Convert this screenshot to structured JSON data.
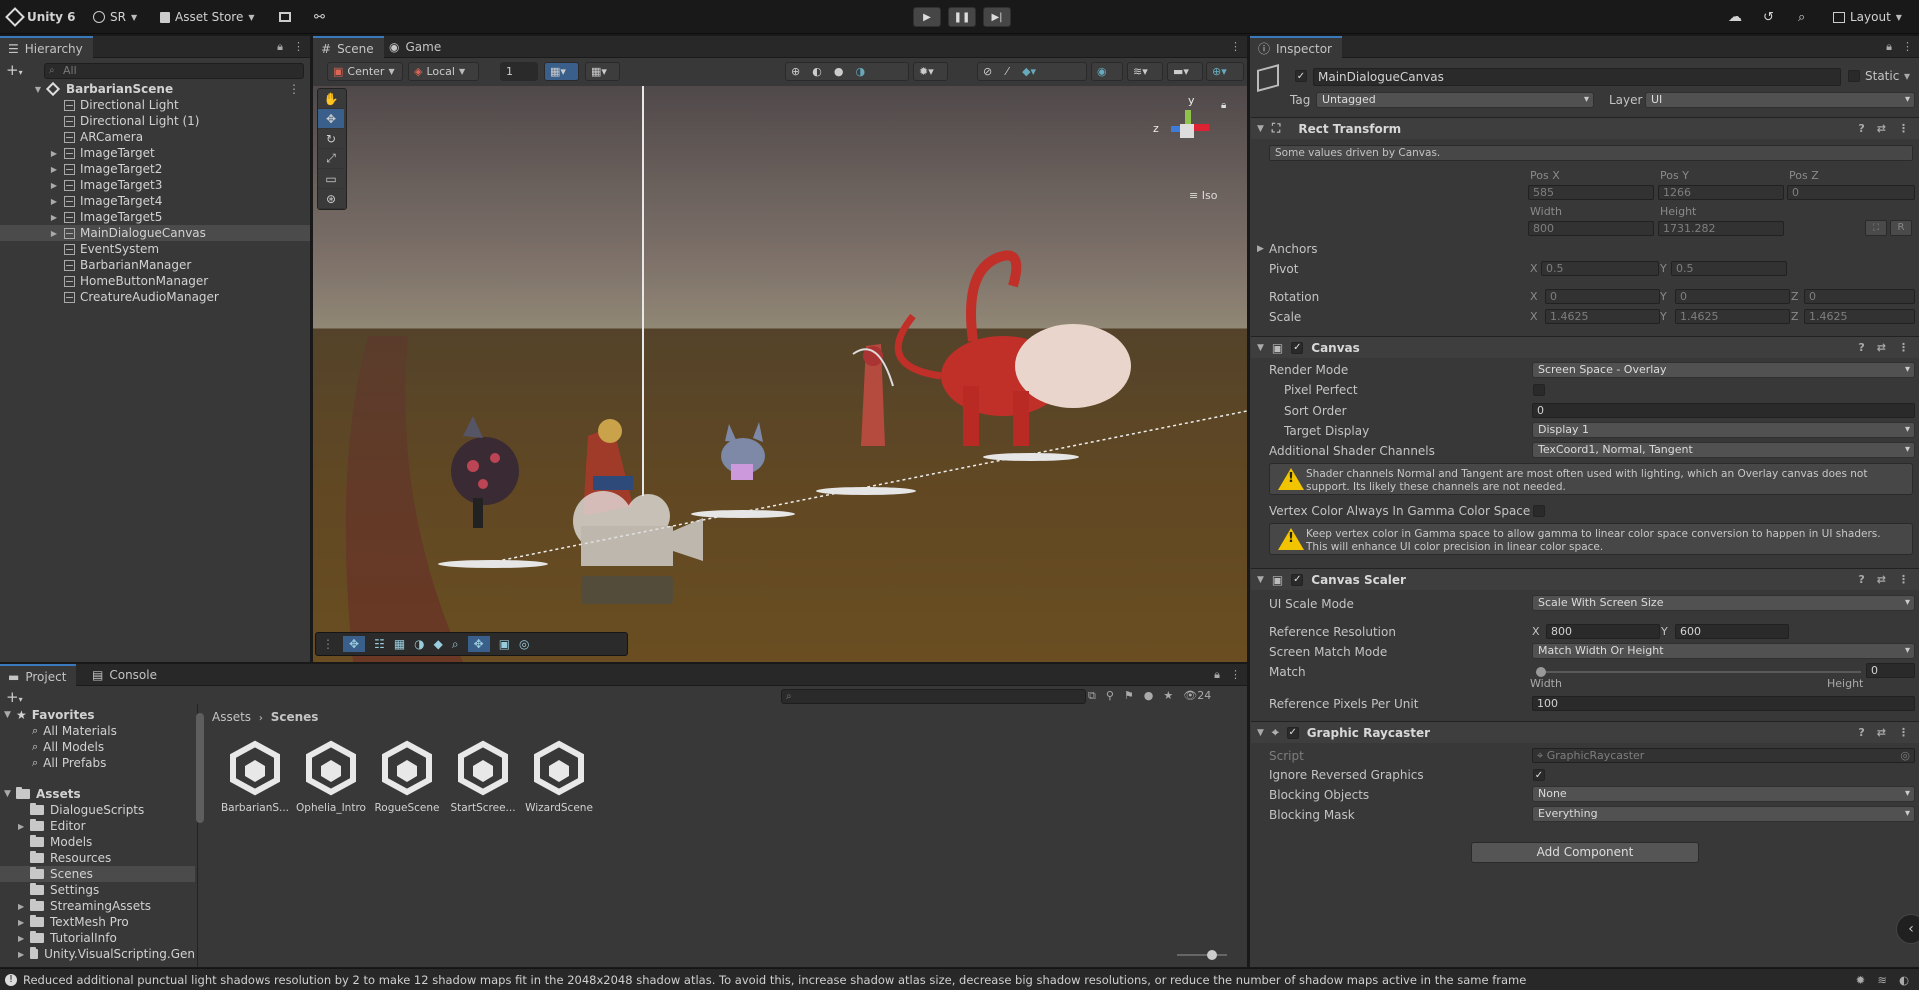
{
  "toolbar": {
    "app_title": "Unity 6",
    "account": "SR",
    "asset_store": "Asset Store",
    "layout": "Layout"
  },
  "hierarchy": {
    "tab": "Hierarchy",
    "search_placeholder": "All",
    "scene_name": "BarbarianScene",
    "items": [
      {
        "label": "Directional Light",
        "expandable": false
      },
      {
        "label": "Directional Light (1)",
        "expandable": false
      },
      {
        "label": "ARCamera",
        "expandable": false
      },
      {
        "label": "ImageTarget",
        "expandable": true
      },
      {
        "label": "ImageTarget2",
        "expandable": true
      },
      {
        "label": "ImageTarget3",
        "expandable": true
      },
      {
        "label": "ImageTarget4",
        "expandable": true
      },
      {
        "label": "ImageTarget5",
        "expandable": true
      },
      {
        "label": "MainDialogueCanvas",
        "expandable": true,
        "selected": true
      },
      {
        "label": "EventSystem",
        "expandable": false
      },
      {
        "label": "BarbarianManager",
        "expandable": false
      },
      {
        "label": "HomeButtonManager",
        "expandable": false
      },
      {
        "label": "CreatureAudioManager",
        "expandable": false
      }
    ]
  },
  "scene": {
    "tabs": [
      "Scene",
      "Game"
    ],
    "pivot": "Center",
    "space": "Local",
    "grid_value": "1",
    "gizmo_y": "y",
    "gizmo_z": "z",
    "projection": "Iso"
  },
  "inspector": {
    "tab": "Inspector",
    "object_name": "MainDialogueCanvas",
    "static_label": "Static",
    "tag_label": "Tag",
    "tag_value": "Untagged",
    "layer_label": "Layer",
    "layer_value": "UI",
    "rect_transform": {
      "title": "Rect Transform",
      "driven_note": "Some values driven by Canvas.",
      "pos_x_label": "Pos X",
      "pos_y_label": "Pos Y",
      "pos_z_label": "Pos Z",
      "pos_x": "585",
      "pos_y": "1266",
      "pos_z": "0",
      "width_label": "Width",
      "height_label": "Height",
      "width": "800",
      "height": "1731.282",
      "anchors_label": "Anchors",
      "pivot_label": "Pivot",
      "pivot_x": "0.5",
      "pivot_y": "0.5",
      "rotation_label": "Rotation",
      "rot_x": "0",
      "rot_y": "0",
      "rot_z": "0",
      "scale_label": "Scale",
      "scale_x": "1.4625",
      "scale_y": "1.4625",
      "scale_z": "1.4625",
      "r_button": "R"
    },
    "canvas": {
      "title": "Canvas",
      "render_mode_label": "Render Mode",
      "render_mode": "Screen Space - Overlay",
      "pixel_perfect_label": "Pixel Perfect",
      "sort_order_label": "Sort Order",
      "sort_order": "0",
      "target_display_label": "Target Display",
      "target_display": "Display 1",
      "shader_channels_label": "Additional Shader Channels",
      "shader_channels": "TexCoord1, Normal, Tangent",
      "warning1": "Shader channels Normal and Tangent are most often used with lighting, which an Overlay canvas does not support. Its likely these channels are not needed.",
      "vertex_color_label": "Vertex Color Always In Gamma Color Space",
      "warning2": "Keep vertex color in Gamma space to allow gamma to linear color space conversion to happen in UI shaders. This will enhance UI color precision in linear color space."
    },
    "canvas_scaler": {
      "title": "Canvas Scaler",
      "ui_scale_mode_label": "UI Scale Mode",
      "ui_scale_mode": "Scale With Screen Size",
      "ref_res_label": "Reference Resolution",
      "ref_x": "800",
      "ref_y": "600",
      "match_mode_label": "Screen Match Mode",
      "match_mode": "Match Width Or Height",
      "match_label": "Match",
      "match_value": "0",
      "match_fraction": 0,
      "width_label": "Width",
      "height_label": "Height",
      "ppu_label": "Reference Pixels Per Unit",
      "ppu": "100"
    },
    "graphic_raycaster": {
      "title": "Graphic Raycaster",
      "script_label": "Script",
      "script": "GraphicRaycaster",
      "ignore_label": "Ignore Reversed Graphics",
      "blocking_objects_label": "Blocking Objects",
      "blocking_objects": "None",
      "blocking_mask_label": "Blocking Mask",
      "blocking_mask": "Everything"
    },
    "add_component": "Add Component",
    "axis_x": "X",
    "axis_y": "Y",
    "axis_z": "Z"
  },
  "project": {
    "tabs": [
      "Project",
      "Console"
    ],
    "count": "24",
    "favorites_label": "Favorites",
    "favorites": [
      "All Materials",
      "All Models",
      "All Prefabs"
    ],
    "assets_label": "Assets",
    "folders": [
      {
        "label": "DialogueScripts",
        "expandable": false
      },
      {
        "label": "Editor",
        "expandable": true
      },
      {
        "label": "Models",
        "expandable": false
      },
      {
        "label": "Resources",
        "expandable": false
      },
      {
        "label": "Scenes",
        "expandable": false,
        "selected": true
      },
      {
        "label": "Settings",
        "expandable": false
      },
      {
        "label": "StreamingAssets",
        "expandable": true
      },
      {
        "label": "TextMesh Pro",
        "expandable": true
      },
      {
        "label": "TutorialInfo",
        "expandable": true
      },
      {
        "label": "Unity.VisualScripting.Gen",
        "expandable": true
      }
    ],
    "breadcrumb": [
      "Assets",
      "Scenes"
    ],
    "assets": [
      "BarbarianS...",
      "Ophelia_Intro",
      "RogueScene",
      "StartScree...",
      "WizardScene"
    ]
  },
  "status": {
    "message": "Reduced additional punctual light shadows resolution by 2 to make 12 shadow maps fit in the 2048x2048 shadow atlas. To avoid this, increase shadow atlas size, decrease big shadow resolutions, or reduce the number of shadow maps active in the same frame"
  },
  "colors": {
    "accent": "#3a79bb",
    "selection": "#4b4b4b",
    "warning": "#f2c400"
  }
}
